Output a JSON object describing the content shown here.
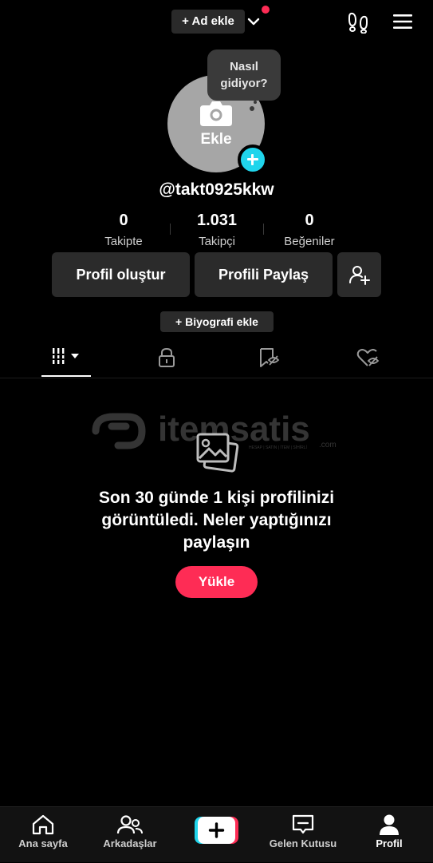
{
  "top_bar": {
    "add_name_label": "+ Ad ekle"
  },
  "avatar": {
    "label": "Ekle",
    "bubble_text": "Nasıl gidiyor?"
  },
  "profile": {
    "username": "@takt0925kkw"
  },
  "stats": [
    {
      "value": "0",
      "label": "Takipte"
    },
    {
      "value": "1.031",
      "label": "Takipçi"
    },
    {
      "value": "0",
      "label": "Beğeniler"
    }
  ],
  "actions": {
    "edit_profile": "Profil oluştur",
    "share_profile": "Profili Paylaş",
    "add_bio": "+ Biyografi ekle"
  },
  "watermark": {
    "brand": "itemsatis",
    "suffix": ".com",
    "tagline": "HESAP | SATIN | İTEM | SİHİRLİ"
  },
  "empty_state": {
    "message": "Son 30 günde 1 kişi profilinizi görüntüledi. Neler yaptığınızı paylaşın",
    "upload_label": "Yükle"
  },
  "bottom_nav": [
    {
      "label": "Ana sayfa",
      "icon": "home-icon"
    },
    {
      "label": "Arkadaşlar",
      "icon": "friends-icon"
    },
    {
      "label": "",
      "icon": "create-icon"
    },
    {
      "label": "Gelen Kutusu",
      "icon": "inbox-icon"
    },
    {
      "label": "Profil",
      "icon": "profile-icon"
    }
  ],
  "colors": {
    "accent": "#fe2c55",
    "cyan": "#20d5ec",
    "background": "#000000",
    "surface": "#2b2b2b"
  }
}
